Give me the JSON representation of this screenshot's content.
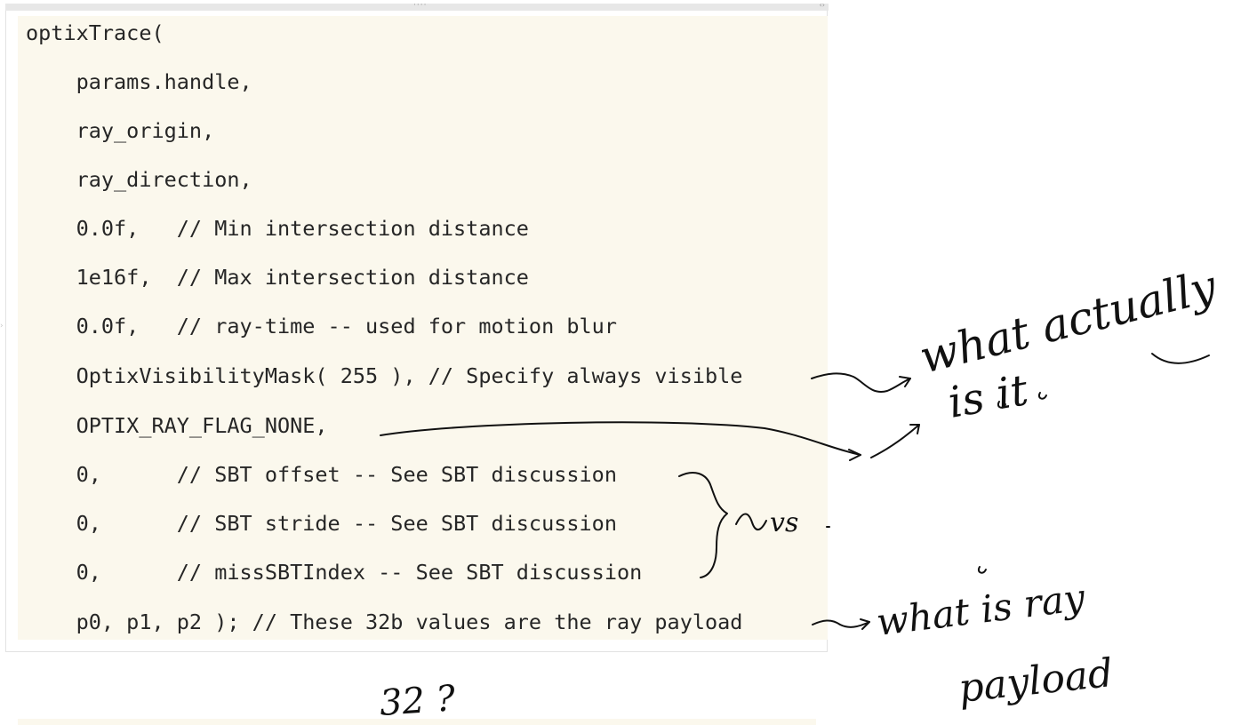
{
  "code": {
    "lines": [
      "optixTrace(",
      "    params.handle,",
      "    ray_origin,",
      "    ray_direction,",
      "    0.0f,   // Min intersection distance",
      "    1e16f,  // Max intersection distance",
      "    0.0f,   // ray-time -- used for motion blur",
      "    OptixVisibilityMask( 255 ), // Specify always visible",
      "    OPTIX_RAY_FLAG_NONE,",
      "    0,      // SBT offset -- See SBT discussion",
      "    0,      // SBT stride -- See SBT discussion",
      "    0,      // missSBTIndex -- See SBT discussion",
      "    p0, p1, p2 ); // These 32b values are the ray payload"
    ]
  },
  "annotations": {
    "note_visibility_line1": "what actually",
    "note_visibility_line2": "is it",
    "note_sbt": "vs",
    "note_payload_line1": "what is ray",
    "note_payload_line2": "payload",
    "note_32": "32 ?"
  }
}
